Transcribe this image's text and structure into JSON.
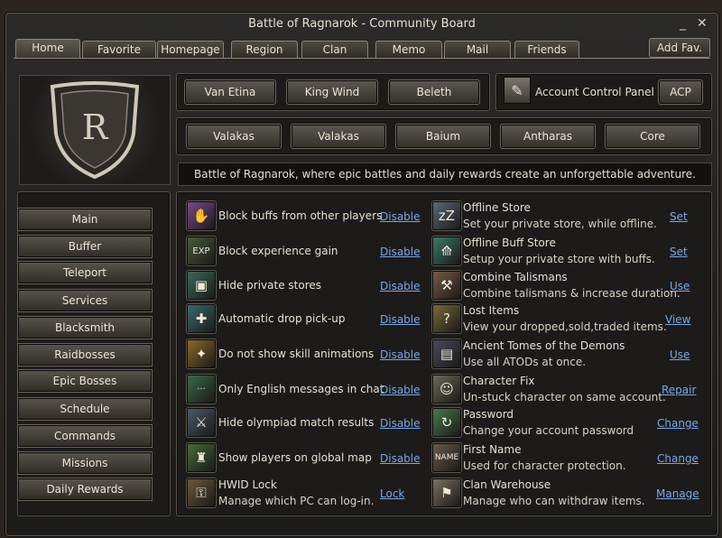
{
  "window": {
    "title": "Battle of Ragnarok - Community Board",
    "minimize": "_",
    "close": "✕"
  },
  "tabs": [
    {
      "label": "Home",
      "active": true
    },
    {
      "label": "Favorite"
    },
    {
      "label": "Homepage"
    },
    {
      "label": "Region"
    },
    {
      "label": "Clan"
    },
    {
      "label": "Memo"
    },
    {
      "label": "Mail"
    },
    {
      "label": "Friends"
    }
  ],
  "add_fav_label": "Add Fav.",
  "emblem_letter": "R",
  "top_buttons": [
    "Van Etina",
    "King Wind",
    "Beleth"
  ],
  "account_panel": {
    "label": "Account Control Panel",
    "button": "ACP",
    "icon": "tools-icon"
  },
  "boss_buttons": [
    "Valakas",
    "Valakas",
    "Baium",
    "Antharas",
    "Core"
  ],
  "marquee": "Battle of Ragnarok, where epic battles and daily rewards create an unforgettable adventure.",
  "sidebar": [
    "Main",
    "Buffer",
    "Teleport",
    "Services",
    "Blacksmith",
    "Raidbosses",
    "Epic Bosses",
    "Schedule",
    "Commands",
    "Missions",
    "Daily Rewards"
  ],
  "left_options": [
    {
      "title": "Block buffs from other players",
      "link": "Disable",
      "icon": "buff-block-icon",
      "glyph": "✋",
      "color": "#7a4a8a"
    },
    {
      "title": "Block experience gain",
      "link": "Disable",
      "icon": "exp-icon",
      "glyph": "EXP",
      "color": "#4a5a3a"
    },
    {
      "title": "Hide private stores",
      "link": "Disable",
      "icon": "store-hide-icon",
      "glyph": "▣",
      "color": "#3a6a5a"
    },
    {
      "title": "Automatic drop pick-up",
      "link": "Disable",
      "icon": "pickup-icon",
      "glyph": "✚",
      "color": "#3a6a6a"
    },
    {
      "title": "Do not show skill animations",
      "link": "Disable",
      "icon": "skill-anim-icon",
      "glyph": "✦",
      "color": "#8a6a2a"
    },
    {
      "title": "Only English messages in chat",
      "link": "Disable",
      "icon": "chat-icon",
      "glyph": "···",
      "color": "#3a6a4a"
    },
    {
      "title": "Hide olympiad match results",
      "link": "Disable",
      "icon": "olympiad-icon",
      "glyph": "⚔",
      "color": "#4a5a6a"
    },
    {
      "title": "Show players on global map",
      "link": "Disable",
      "icon": "map-icon",
      "glyph": "♜",
      "color": "#4a6a3a"
    },
    {
      "title": "HWID Lock",
      "desc": "Manage which PC can log-in.",
      "link": "Lock",
      "icon": "key-icon",
      "glyph": "⚿",
      "color": "#6a5a3a"
    }
  ],
  "right_options": [
    {
      "title": "Offline Store",
      "desc": "Set your private store, while offline.",
      "link": "Set",
      "icon": "offline-store-icon",
      "glyph": "zZ",
      "color": "#5a6a7a"
    },
    {
      "title": "Offline Buff Store",
      "desc": "Setup your private store with buffs.",
      "link": "Set",
      "icon": "buff-store-icon",
      "glyph": "⟰",
      "color": "#3a7a6a"
    },
    {
      "title": "Combine Talismans",
      "desc": "Combine talismans & increase duration.",
      "link": "Use",
      "icon": "talisman-icon",
      "glyph": "⚒",
      "color": "#7a5a4a"
    },
    {
      "title": "Lost Items",
      "desc": "View your dropped,sold,traded items.",
      "link": "View",
      "icon": "lost-items-icon",
      "glyph": "?",
      "color": "#7a6a3a"
    },
    {
      "title": "Ancient Tomes of the Demons",
      "desc": "Use all ATODs at once.",
      "link": "Use",
      "icon": "tome-icon",
      "glyph": "▤",
      "color": "#4a4a5a"
    },
    {
      "title": "Character Fix",
      "desc": "Un-stuck character on same account.",
      "link": "Repair",
      "icon": "character-fix-icon",
      "glyph": "☺",
      "color": "#6a6a5a"
    },
    {
      "title": "Password",
      "desc": "Change your account password",
      "link": "Change",
      "icon": "password-icon",
      "glyph": "↻",
      "color": "#4a7a4a"
    },
    {
      "title": "First Name",
      "desc": "Used for character protection.",
      "link": "Change",
      "icon": "name-tag-icon",
      "glyph": "NAME",
      "color": "#6a5a4a"
    },
    {
      "title": "Clan Warehouse",
      "desc": "Manage who can withdraw items.",
      "link": "Manage",
      "icon": "warehouse-icon",
      "glyph": "⚑",
      "color": "#7a7060"
    }
  ]
}
